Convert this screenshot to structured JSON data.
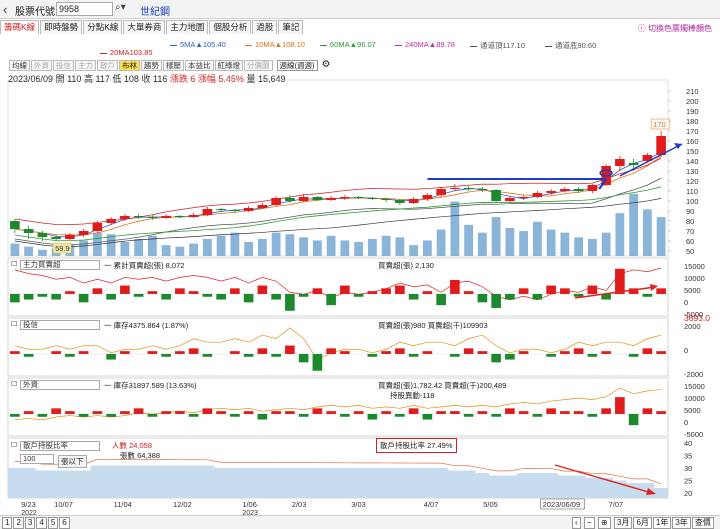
{
  "header": {
    "code_label": "股票代號",
    "code_value": "9958",
    "stock_name": "世紀鋼"
  },
  "tabs": [
    "籌碼K線",
    "即時盤勢",
    "分點K線",
    "大單券商",
    "主力地圖",
    "個股分析",
    "過股",
    "筆記"
  ],
  "style_link": "切換色票燭棒顏色",
  "ma_legend": [
    {
      "label": "5MA",
      "value": "▲105.40",
      "color": "#2b5fcf"
    },
    {
      "label": "10MA",
      "value": "▲108.10",
      "color": "#e0701a"
    },
    {
      "label": "60MA",
      "value": "▲96.07",
      "color": "#2e9c2e"
    },
    {
      "label": "240MA",
      "value": "▲89.78",
      "color": "#c02b9c"
    },
    {
      "label": "通道頂",
      "value": "117.10",
      "color": "#555555"
    },
    {
      "label": "通道底",
      "value": "90.60",
      "color": "#555555"
    },
    {
      "label": "20MA",
      "value": "103.85",
      "color": "#d42020"
    }
  ],
  "toolbar": {
    "buttons": [
      "均線",
      "外資",
      "投信",
      "主力",
      "散戶",
      "布林",
      "趨勢",
      "樣壓",
      "本益比",
      "紅綠燈",
      "分價圖"
    ],
    "active": "布林",
    "period": "週線(週週)"
  },
  "info": {
    "date": "2023/06/09",
    "open_label": "開",
    "open": "110",
    "high_label": "高",
    "high": "117",
    "low_label": "低",
    "low": "108",
    "close_label": "收",
    "close": "116",
    "change": "漲跌 6",
    "pct": "漲幅 5.45%",
    "vol_label": "量",
    "vol": "15,649"
  },
  "price_chart": {
    "y_ticks": [
      "210",
      "200",
      "190",
      "180",
      "170",
      "160",
      "150",
      "140",
      "130",
      "120",
      "110",
      "100",
      "90",
      "80",
      "70",
      "60",
      "50"
    ],
    "high_label": "170",
    "low_label": "59.9",
    "candles": [
      {
        "o": 80,
        "c": 72,
        "h": 82,
        "l": 68
      },
      {
        "o": 72,
        "c": 68,
        "h": 75,
        "l": 62
      },
      {
        "o": 68,
        "c": 64,
        "h": 70,
        "l": 60
      },
      {
        "o": 64,
        "c": 62,
        "h": 66,
        "l": 59.9
      },
      {
        "o": 62,
        "c": 66,
        "h": 68,
        "l": 61
      },
      {
        "o": 66,
        "c": 70,
        "h": 72,
        "l": 64
      },
      {
        "o": 70,
        "c": 78,
        "h": 80,
        "l": 68
      },
      {
        "o": 78,
        "c": 82,
        "h": 84,
        "l": 76
      },
      {
        "o": 82,
        "c": 85,
        "h": 87,
        "l": 80
      },
      {
        "o": 85,
        "c": 84,
        "h": 87,
        "l": 82
      },
      {
        "o": 84,
        "c": 83,
        "h": 86,
        "l": 81
      },
      {
        "o": 83,
        "c": 85,
        "h": 87,
        "l": 82
      },
      {
        "o": 85,
        "c": 84,
        "h": 86,
        "l": 83
      },
      {
        "o": 84,
        "c": 86,
        "h": 88,
        "l": 83
      },
      {
        "o": 86,
        "c": 92,
        "h": 94,
        "l": 85
      },
      {
        "o": 92,
        "c": 91,
        "h": 93,
        "l": 89
      },
      {
        "o": 91,
        "c": 90,
        "h": 92,
        "l": 88
      },
      {
        "o": 90,
        "c": 93,
        "h": 95,
        "l": 89
      },
      {
        "o": 93,
        "c": 96,
        "h": 98,
        "l": 92
      },
      {
        "o": 96,
        "c": 103,
        "h": 105,
        "l": 95
      },
      {
        "o": 103,
        "c": 100,
        "h": 106,
        "l": 98
      },
      {
        "o": 100,
        "c": 104,
        "h": 107,
        "l": 99
      },
      {
        "o": 104,
        "c": 101,
        "h": 105,
        "l": 100
      },
      {
        "o": 101,
        "c": 103,
        "h": 105,
        "l": 100
      },
      {
        "o": 103,
        "c": 104,
        "h": 106,
        "l": 101
      },
      {
        "o": 104,
        "c": 103,
        "h": 105,
        "l": 102
      },
      {
        "o": 103,
        "c": 102,
        "h": 104,
        "l": 101
      },
      {
        "o": 102,
        "c": 101,
        "h": 103,
        "l": 99
      },
      {
        "o": 101,
        "c": 98,
        "h": 102,
        "l": 96
      },
      {
        "o": 98,
        "c": 102,
        "h": 104,
        "l": 97
      },
      {
        "o": 102,
        "c": 106,
        "h": 108,
        "l": 100
      },
      {
        "o": 106,
        "c": 112,
        "h": 114,
        "l": 104
      },
      {
        "o": 112,
        "c": 113,
        "h": 117,
        "l": 110
      },
      {
        "o": 113,
        "c": 112,
        "h": 115,
        "l": 110
      },
      {
        "o": 112,
        "c": 111,
        "h": 114,
        "l": 109
      },
      {
        "o": 111,
        "c": 100,
        "h": 112,
        "l": 98
      },
      {
        "o": 100,
        "c": 103,
        "h": 105,
        "l": 99
      },
      {
        "o": 103,
        "c": 104,
        "h": 106,
        "l": 101
      },
      {
        "o": 104,
        "c": 108,
        "h": 110,
        "l": 103
      },
      {
        "o": 108,
        "c": 110,
        "h": 112,
        "l": 106
      },
      {
        "o": 110,
        "c": 112,
        "h": 114,
        "l": 109
      },
      {
        "o": 112,
        "c": 110,
        "h": 114,
        "l": 108
      },
      {
        "o": 110,
        "c": 116,
        "h": 117,
        "l": 108
      },
      {
        "o": 116,
        "c": 135,
        "h": 137,
        "l": 115
      },
      {
        "o": 135,
        "c": 142,
        "h": 145,
        "l": 130
      },
      {
        "o": 138,
        "c": 136,
        "h": 142,
        "l": 130
      },
      {
        "o": 140,
        "c": 146,
        "h": 148,
        "l": 138
      },
      {
        "o": 146,
        "c": 165,
        "h": 170,
        "l": 144
      }
    ],
    "volume": [
      16,
      12,
      8,
      10,
      14,
      20,
      30,
      28,
      18,
      22,
      26,
      14,
      12,
      16,
      22,
      26,
      30,
      18,
      22,
      30,
      28,
      24,
      20,
      26,
      20,
      18,
      22,
      26,
      24,
      14,
      20,
      34,
      70,
      40,
      30,
      50,
      36,
      32,
      44,
      34,
      30,
      24,
      22,
      30,
      55,
      80,
      60,
      50
    ]
  },
  "panels": [
    {
      "select": "主力買賣超",
      "left_text": "一 累計買賣超(張) 8,072",
      "right_text": "買賣超(張) 2,130",
      "ticks": [
        "15000",
        "10000",
        "5000",
        "0",
        "-5000"
      ],
      "extra": "",
      "bars": [
        -3,
        -2,
        -1,
        -2,
        1,
        -3,
        2,
        -2,
        3,
        -1,
        1,
        -2,
        2,
        1,
        -1,
        -2,
        2,
        -3,
        3,
        -2,
        -6,
        -1,
        2,
        -4,
        3,
        -1,
        1,
        2,
        3,
        -2,
        1,
        -4,
        5,
        1,
        -3,
        -5,
        -2,
        2,
        -2,
        3,
        2,
        -1,
        3,
        -2,
        9,
        2,
        -1,
        2
      ]
    },
    {
      "select": "投信",
      "left_text": "一 庫存4375.864 (1.87%)",
      "right_text": "買賣超(張)980 買賣超(千)109903",
      "ticks": [
        "2000",
        "0",
        "-2000"
      ],
      "extra": "3693.0",
      "bars": [
        1,
        -1,
        0,
        1,
        -1,
        1,
        0,
        -2,
        1,
        0,
        1,
        -1,
        1,
        2,
        -1,
        0,
        1,
        -1,
        2,
        -1,
        3,
        -3,
        -6,
        2,
        1,
        0,
        -1,
        1,
        2,
        -1,
        1,
        0,
        -1,
        2,
        1,
        -3,
        -2,
        1,
        0,
        -1,
        1,
        2,
        -1,
        1,
        0,
        -1,
        2,
        1
      ]
    },
    {
      "select": "外資",
      "left_text": "一 庫存31897.589 (13.63%)",
      "right_text": "買賣超(張)1,782.42 買賣超(千)200,489",
      "right_text2": "持股異動-118",
      "ticks": [
        "15000",
        "10000",
        "5000",
        "0",
        "-5000"
      ],
      "extra": "",
      "bars": [
        -1,
        1,
        -1,
        2,
        1,
        -1,
        1,
        -1,
        1,
        2,
        -1,
        1,
        1,
        -1,
        2,
        1,
        -1,
        1,
        -2,
        1,
        1,
        -1,
        2,
        1,
        -1,
        1,
        -2,
        1,
        -1,
        2,
        -2,
        1,
        1,
        -1,
        1,
        -1,
        2,
        1,
        -1,
        2,
        1,
        1,
        -1,
        2,
        6,
        -4,
        2,
        1
      ]
    }
  ],
  "retail_panel": {
    "select": "散戶持股比率",
    "count_select": "100",
    "count_label": "張以下",
    "people": "人數 24,058",
    "shares": "張數 64,388",
    "ratio_label": "散戶持股比率 27.49%",
    "ticks": [
      "40",
      "35",
      "30",
      "25",
      "20"
    ],
    "values": [
      30,
      30,
      29,
      29,
      29,
      29,
      31,
      31,
      31,
      31,
      31,
      31,
      31,
      31,
      31,
      30,
      30,
      30,
      30,
      30,
      30,
      30,
      30,
      30,
      30,
      30,
      30,
      30,
      30,
      30,
      30,
      30,
      29,
      29,
      28,
      27,
      27,
      28,
      28,
      28,
      27,
      27,
      26,
      26,
      25,
      24,
      24,
      22
    ]
  },
  "x_axis": [
    {
      "label": "9/23",
      "sub": "2022",
      "pos": 0.02
    },
    {
      "label": "10/07",
      "sub": "",
      "pos": 0.07
    },
    {
      "label": "11/04",
      "sub": "",
      "pos": 0.16
    },
    {
      "label": "12/02",
      "sub": "",
      "pos": 0.25
    },
    {
      "label": "1/06",
      "sub": "2023",
      "pos": 0.355
    },
    {
      "label": "2/03",
      "sub": "",
      "pos": 0.43
    },
    {
      "label": "3/03",
      "sub": "",
      "pos": 0.52
    },
    {
      "label": "4/07",
      "sub": "",
      "pos": 0.63
    },
    {
      "label": "5/05",
      "sub": "",
      "pos": 0.72
    },
    {
      "label": "2023/06/09",
      "sub": "",
      "pos": 0.81
    },
    {
      "label": "7/07",
      "sub": "",
      "pos": 0.91
    }
  ],
  "bottom": {
    "pages": [
      "1",
      "2",
      "3",
      "4",
      "5",
      "6"
    ],
    "ranges": [
      "3月",
      "6月",
      "1年",
      "3年",
      "查價"
    ]
  },
  "colors": {
    "up": "#e01b1b",
    "down": "#1c8a2c",
    "volume": "#8bb4d9",
    "arrow": "#e02222",
    "line": "#1c3fc4"
  }
}
